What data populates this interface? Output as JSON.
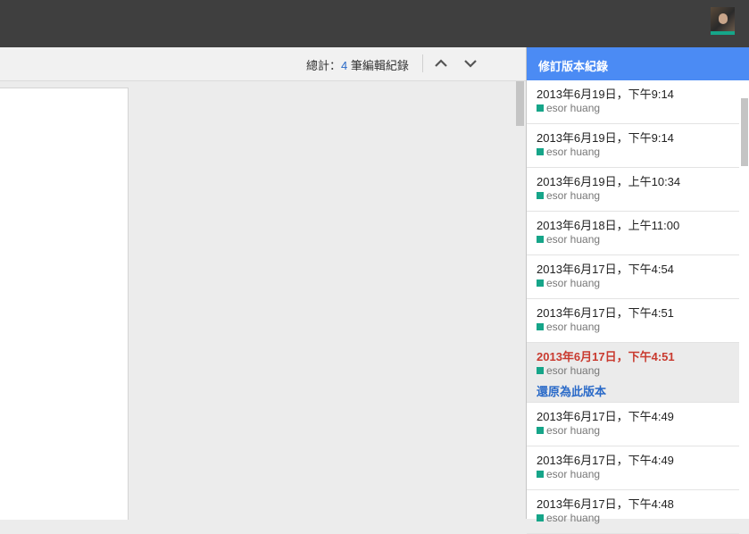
{
  "toolbar": {
    "total_prefix": "總計：",
    "total_count": "4",
    "total_suffix": " 筆編輯紀錄",
    "up_icon": "chevron-up-icon",
    "down_icon": "chevron-down-icon"
  },
  "panel": {
    "title": "修訂版本紀錄",
    "restore_label": "還原為此版本",
    "author_color": "#16a589",
    "header_color": "#4b8bf4",
    "revisions": [
      {
        "time": "2013年6月19日，下午9:14",
        "author": "esor huang"
      },
      {
        "time": "2013年6月19日，下午9:14",
        "author": "esor huang"
      },
      {
        "time": "2013年6月19日，上午10:34",
        "author": "esor huang"
      },
      {
        "time": "2013年6月18日，上午11:00",
        "author": "esor huang"
      },
      {
        "time": "2013年6月17日，下午4:54",
        "author": "esor huang"
      },
      {
        "time": "2013年6月17日，下午4:51",
        "author": "esor huang"
      },
      {
        "time": "2013年6月17日，下午4:51",
        "author": "esor huang"
      },
      {
        "time": "2013年6月17日，下午4:49",
        "author": "esor huang"
      },
      {
        "time": "2013年6月17日，下午4:49",
        "author": "esor huang"
      },
      {
        "time": "2013年6月17日，下午4:48",
        "author": "esor huang"
      }
    ]
  }
}
